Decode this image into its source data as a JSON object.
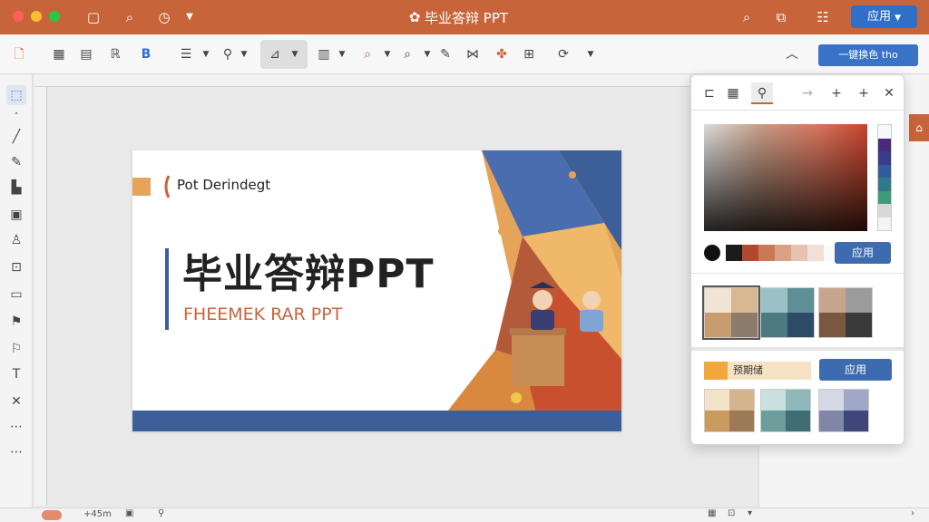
{
  "app": {
    "title": "毕业答辩 PPT",
    "apply_label": "应用",
    "toolbar_action_label": "一键换色 tho"
  },
  "slide": {
    "small_label": "Pot Derindegt",
    "title": "毕业答辩PPT",
    "subtitle": "FHEEMEK RAR PPT"
  },
  "popup": {
    "apply_label_1": "应用",
    "apply_label_2": "应用",
    "preview_label": "预期储",
    "strip_colors": [
      "#1b1b1b",
      "#b04a2e",
      "#c97a55",
      "#d9a285",
      "#e6c3b0",
      "#f1e0d6",
      "#fafafa"
    ],
    "side_colors": [
      "#f6f8fb",
      "#4a2a7a",
      "#3b3b8c",
      "#2f5c9a",
      "#2f7a8a",
      "#3f9a7a",
      "#d8d8d8",
      "#f4f4f4"
    ],
    "preview_color": "#f0a73c",
    "preview_bg": "#f8e2c4"
  },
  "status": {
    "zoom": "+45m"
  },
  "colors": {
    "brand": "#c8643a",
    "accent": "#2f6fc7"
  }
}
